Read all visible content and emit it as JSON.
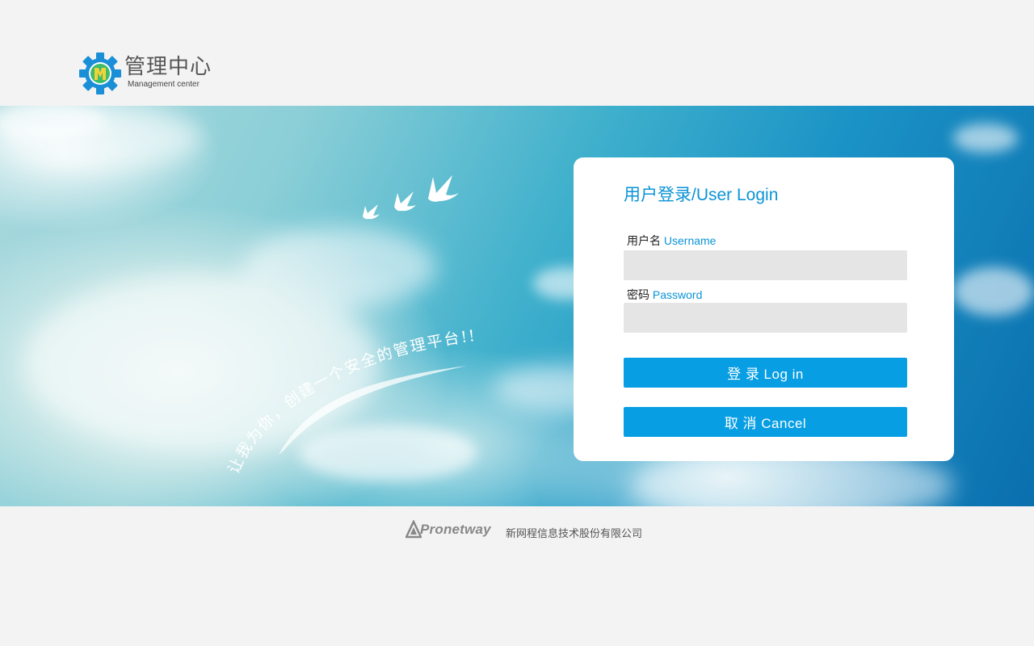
{
  "header": {
    "logo_title": "管理中心",
    "logo_subtitle": "Management center",
    "logo_icon": "gear-m-icon"
  },
  "banner": {
    "slogan": "让我为你，创建一个安全的管理平台!!",
    "decoration": "flying-doves"
  },
  "login": {
    "title": "用户登录/User Login",
    "username_label_cn": "用户名",
    "username_label_en": "Username",
    "username_value": "",
    "password_label_cn": "密码",
    "password_label_en": "Password",
    "password_value": "",
    "login_button": "登 录  Log in",
    "cancel_button": "取 消  Cancel"
  },
  "footer": {
    "brand": "Pronetway",
    "company": "新网程信息技术股份有限公司"
  },
  "colors": {
    "accent": "#0b93d6",
    "button": "#079ee4",
    "input_bg": "#e6e5e6",
    "page_bg": "#f3f3f3"
  }
}
